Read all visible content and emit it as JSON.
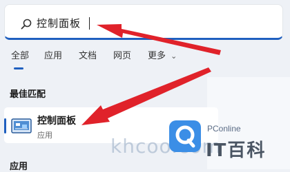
{
  "search": {
    "query": "控制面板"
  },
  "tabs": [
    "全部",
    "应用",
    "文档",
    "网页",
    "更多"
  ],
  "tab_more_chevron": "⌄",
  "sections": {
    "best_match": "最佳匹配",
    "apps": "应用"
  },
  "result": {
    "title": "控制面板",
    "type": "应用"
  },
  "watermark": {
    "site": "khcoo.com",
    "brand": "PConline",
    "chinese": "IT百科"
  },
  "colors": {
    "accent": "#1f5fbf",
    "arrow": "#e0222a"
  }
}
